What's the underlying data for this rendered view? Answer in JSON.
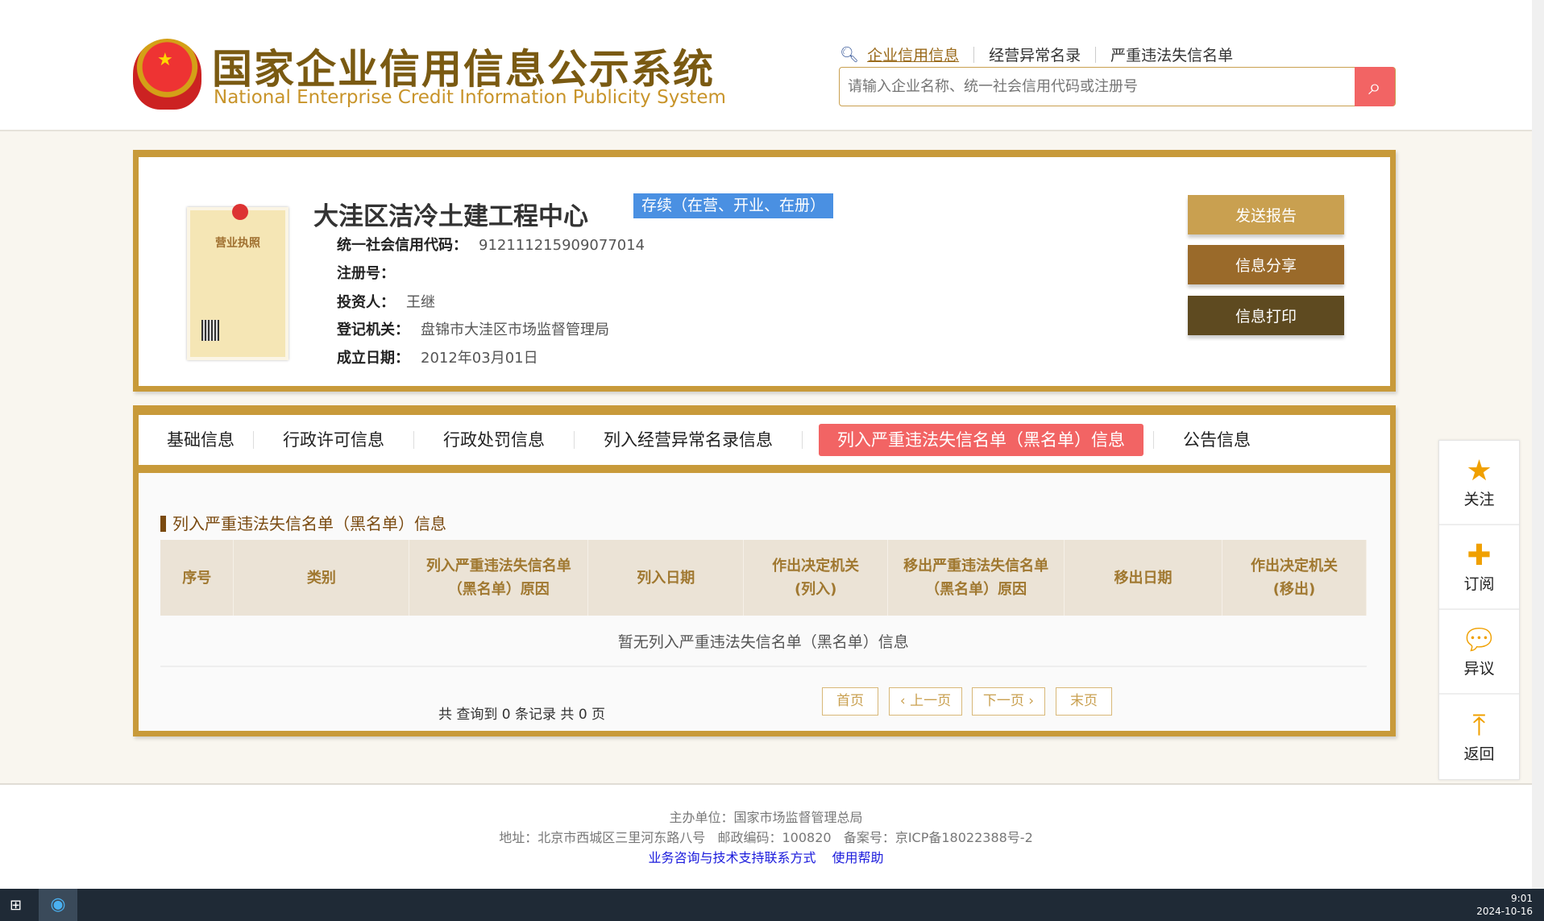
{
  "header": {
    "title_cn": "国家企业信用信息公示系统",
    "title_en": "National Enterprise Credit Information Publicity System",
    "nav": [
      "企业信用信息",
      "经营异常名录",
      "严重违法失信名单"
    ],
    "search_placeholder": "请输入企业名称、统一社会信用代码或注册号"
  },
  "company": {
    "name": "大洼区洁冷土建工程中心",
    "status": "存续（在营、开业、在册）",
    "fields": [
      {
        "label": "统一社会信用代码：",
        "value": "912111215909077014"
      },
      {
        "label": "注册号：",
        "value": ""
      },
      {
        "label": "投资人：",
        "value": "王继"
      },
      {
        "label": "登记机关：",
        "value": "盘锦市大洼区市场监督管理局"
      },
      {
        "label": "成立日期：",
        "value": "2012年03月01日"
      }
    ],
    "license_heading": "营业执照",
    "actions": [
      "发送报告",
      "信息分享",
      "信息打印"
    ]
  },
  "tabs": [
    "基础信息",
    "行政许可信息",
    "行政处罚信息",
    "列入经营异常名录信息",
    "列入严重违法失信名单（黑名单）信息",
    "公告信息"
  ],
  "section": {
    "title": "列入严重违法失信名单（黑名单）信息",
    "columns": [
      "序号",
      "类别",
      "列入严重违法失信名单（黑名单）原因",
      "列入日期",
      "作出决定机关(列入)",
      "移出严重违法失信名单（黑名单）原因",
      "移出日期",
      "作出决定机关(移出)"
    ],
    "empty": "暂无列入严重违法失信名单（黑名单）信息",
    "summary": "共 查询到 0 条记录 共 0 页",
    "pager": [
      "首页",
      "‹ 上一页",
      "下一页 ›",
      "末页"
    ]
  },
  "float": [
    "关注",
    "订阅",
    "异议",
    "返回"
  ],
  "footer": {
    "line1": "主办单位：国家市场监督管理总局",
    "line2": "地址：北京市西城区三里河东路八号   邮政编码：100820   备案号：京ICP备18022388号-2",
    "links": [
      "业务咨询与技术支持联系方式",
      "使用帮助"
    ]
  },
  "taskbar": {
    "time": "9:01",
    "date": "2024-10-16"
  }
}
